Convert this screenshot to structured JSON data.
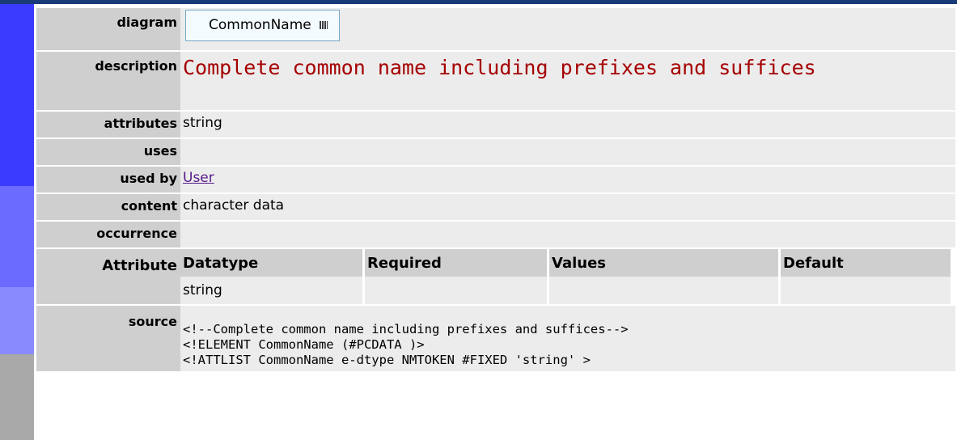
{
  "labels": {
    "diagram": "diagram",
    "description": "description",
    "attributes": "attributes",
    "uses": "uses",
    "used_by": "used by",
    "content": "content",
    "occurrence": "occurrence",
    "attribute": "Attribute",
    "source": "source"
  },
  "diagram": {
    "element_name": "CommonName",
    "icon": "sequence-icon"
  },
  "description": "Complete common name including prefixes and suffices",
  "attributes": "string",
  "uses": "",
  "used_by": {
    "link_text": "User"
  },
  "content": "character data",
  "occurrence": "",
  "attr_table": {
    "headers": [
      "Datatype",
      "Required",
      "Values",
      "Default"
    ],
    "row": [
      "string",
      "",
      "",
      ""
    ]
  },
  "source": [
    "<!--Complete common name including prefixes and suffices-->",
    "<!ELEMENT CommonName (#PCDATA )>",
    "<!ATTLIST CommonName e-dtype NMTOKEN #FIXED 'string' >"
  ],
  "colors": {
    "topbar": "#1a3a78",
    "sidebar_1": "#3b3bff",
    "sidebar_2": "#6b6bff",
    "sidebar_3": "#8a8aff",
    "sidebar_4": "#a9a9a9",
    "description_text": "#a50000",
    "link": "#551a8b"
  }
}
